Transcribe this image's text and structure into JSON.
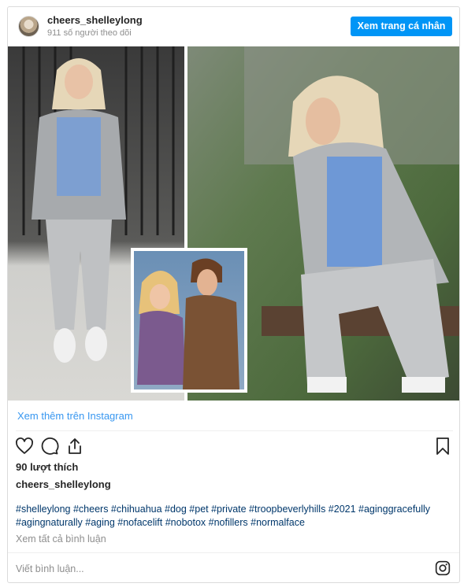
{
  "header": {
    "username": "cheers_shelleylong",
    "followers": "911 số người theo dõi",
    "profile_button": "Xem trang cá nhân"
  },
  "post": {
    "view_more_link": "Xem thêm trên Instagram",
    "likes": "90 lượt thích",
    "caption_username": "cheers_shelleylong",
    "hashtags_line1": "#shelleylong #cheers #chihuahua #dog #pet #private #troopbeverlyhills #2021 #aginggracefully",
    "hashtags_line2": "#agingnaturally #aging #nofacelift #nobotox #nofillers #normalface",
    "view_all_comments": "Xem tất cả bình luận",
    "comment_placeholder": "Viết bình luận..."
  },
  "icons": {
    "like": "heart-icon",
    "comment": "comment-bubble-icon",
    "share": "share-icon",
    "save": "bookmark-icon",
    "instagram": "instagram-icon"
  },
  "colors": {
    "accent": "#0095f6",
    "link": "#3897f0",
    "hashtag": "#00376b",
    "muted": "#8e8e8e"
  }
}
